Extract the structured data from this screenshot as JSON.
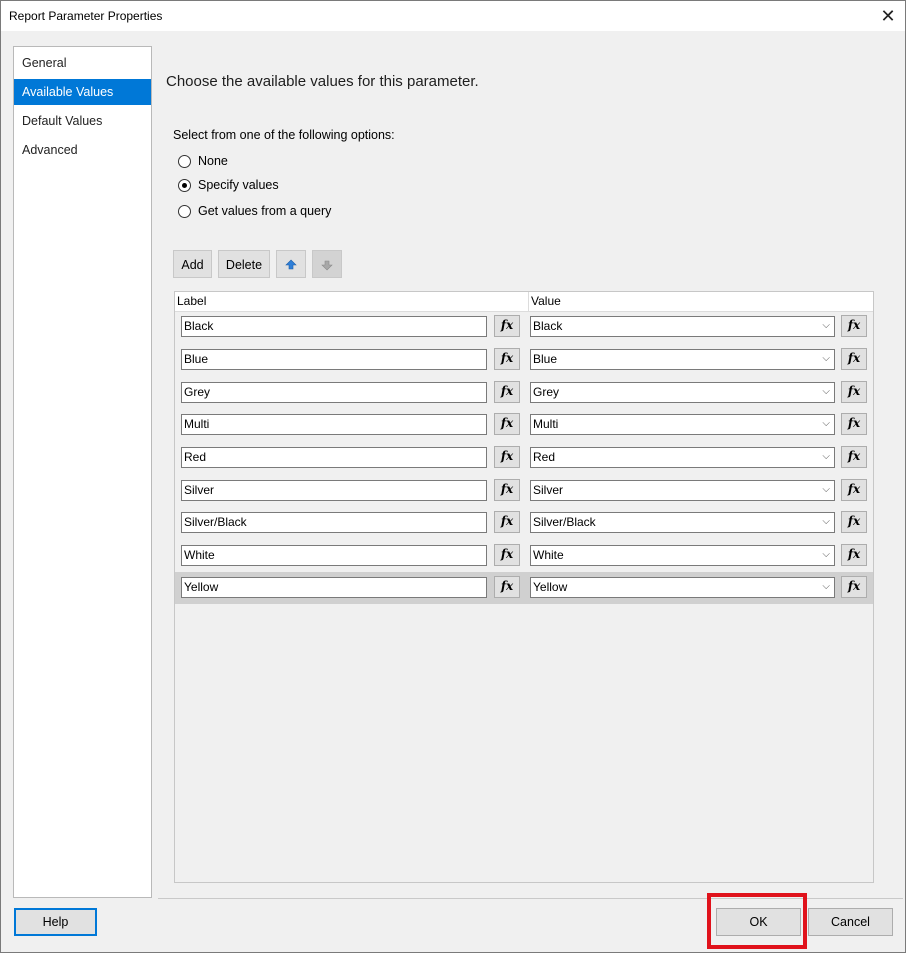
{
  "window": {
    "title": "Report Parameter Properties",
    "close_glyph": "✕"
  },
  "nav": {
    "items": [
      {
        "label": "General"
      },
      {
        "label": "Available Values"
      },
      {
        "label": "Default Values"
      },
      {
        "label": "Advanced"
      }
    ],
    "selected": "Available Values"
  },
  "main": {
    "heading": "Choose the available values for this parameter.",
    "options_label": "Select from one of the following options:",
    "options": [
      {
        "label": "None",
        "checked": false
      },
      {
        "label": "Specify values",
        "checked": true
      },
      {
        "label": "Get values from a query",
        "checked": false
      }
    ]
  },
  "toolbar": {
    "add_label": "Add",
    "delete_label": "Delete",
    "move_up_icon": "arrow-up-icon",
    "move_down_icon": "arrow-down-icon"
  },
  "grid": {
    "columns": {
      "label": "Label",
      "value": "Value"
    },
    "fx_glyph": "fx",
    "chevron_glyph": "⌵",
    "rows": [
      {
        "label": "Black",
        "value": "Black"
      },
      {
        "label": "Blue",
        "value": "Blue"
      },
      {
        "label": "Grey",
        "value": "Grey"
      },
      {
        "label": "Multi",
        "value": "Multi"
      },
      {
        "label": "Red",
        "value": "Red"
      },
      {
        "label": "Silver",
        "value": "Silver"
      },
      {
        "label": "Silver/Black",
        "value": "Silver/Black"
      },
      {
        "label": "White",
        "value": "White"
      },
      {
        "label": "Yellow",
        "value": "Yellow"
      }
    ],
    "selected_row": 8
  },
  "footer": {
    "help_label": "Help",
    "ok_label": "OK",
    "cancel_label": "Cancel"
  },
  "colors": {
    "accent": "#0078d7",
    "highlight": "#e0121b",
    "selected_row": "#d0d0d0"
  }
}
